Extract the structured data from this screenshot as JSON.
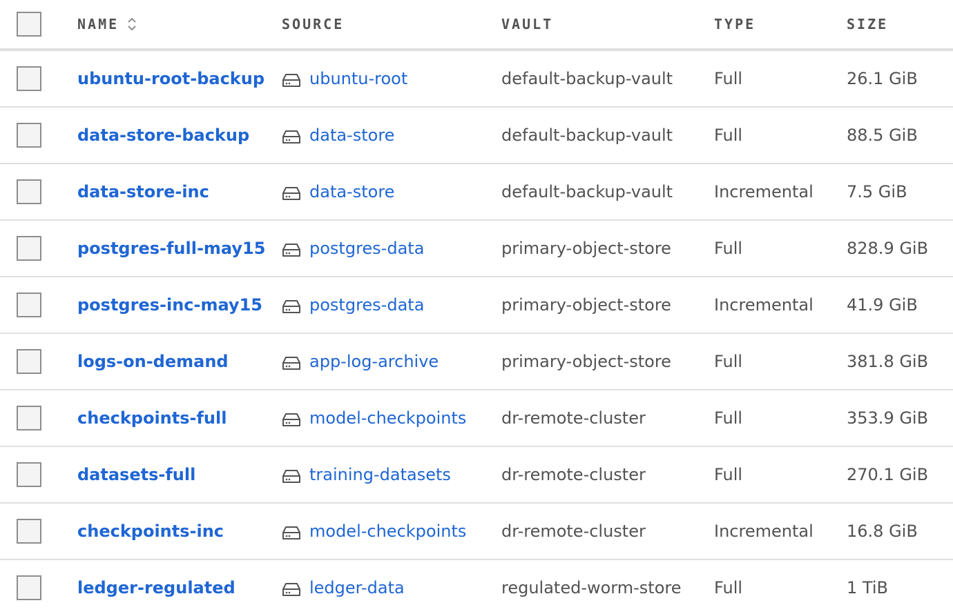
{
  "header": {
    "name": "NAME",
    "source": "SOURCE",
    "vault": "VAULT",
    "type": "TYPE",
    "size": "SIZE"
  },
  "icons": {
    "sort": "sort-icon",
    "source": "drive-icon"
  },
  "colors": {
    "link": "#1f66d4",
    "text": "#525252",
    "divider": "#e0e0e0"
  },
  "rows": [
    {
      "name": "ubuntu-root-backup",
      "source": "ubuntu-root",
      "vault": "default-backup-vault",
      "type": "Full",
      "size": "26.1 GiB"
    },
    {
      "name": "data-store-backup",
      "source": "data-store",
      "vault": "default-backup-vault",
      "type": "Full",
      "size": "88.5 GiB"
    },
    {
      "name": "data-store-inc",
      "source": "data-store",
      "vault": "default-backup-vault",
      "type": "Incremental",
      "size": "7.5 GiB"
    },
    {
      "name": "postgres-full-may15",
      "source": "postgres-data",
      "vault": "primary-object-store",
      "type": "Full",
      "size": "828.9 GiB"
    },
    {
      "name": "postgres-inc-may15",
      "source": "postgres-data",
      "vault": "primary-object-store",
      "type": "Incremental",
      "size": "41.9 GiB"
    },
    {
      "name": "logs-on-demand",
      "source": "app-log-archive",
      "vault": "primary-object-store",
      "type": "Full",
      "size": "381.8 GiB"
    },
    {
      "name": "checkpoints-full",
      "source": "model-checkpoints",
      "vault": "dr-remote-cluster",
      "type": "Full",
      "size": "353.9 GiB"
    },
    {
      "name": "datasets-full",
      "source": "training-datasets",
      "vault": "dr-remote-cluster",
      "type": "Full",
      "size": "270.1 GiB"
    },
    {
      "name": "checkpoints-inc",
      "source": "model-checkpoints",
      "vault": "dr-remote-cluster",
      "type": "Incremental",
      "size": "16.8 GiB"
    },
    {
      "name": "ledger-regulated",
      "source": "ledger-data",
      "vault": "regulated-worm-store",
      "type": "Full",
      "size": "1 TiB"
    }
  ]
}
